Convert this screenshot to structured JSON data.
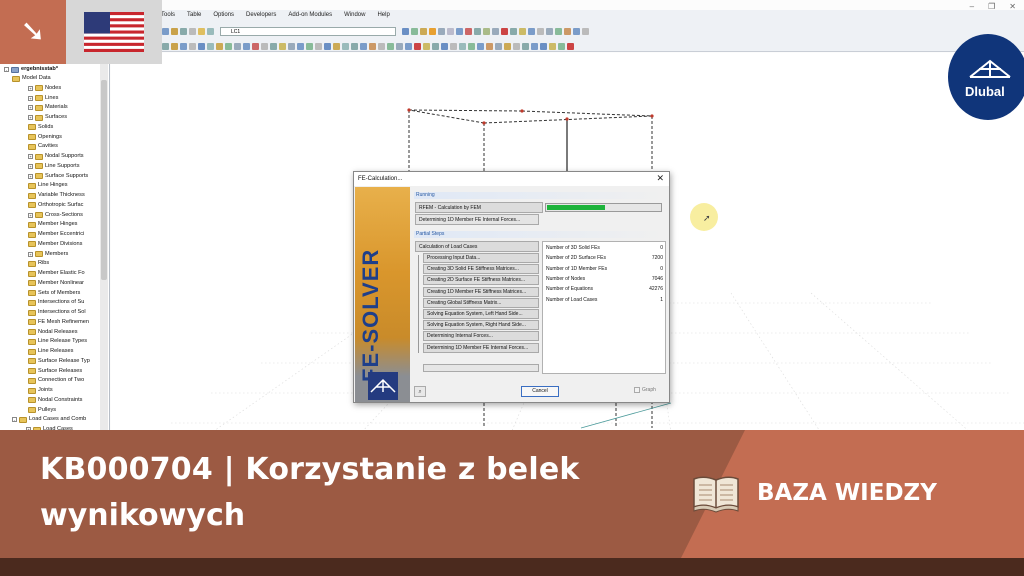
{
  "menu": [
    "Tools",
    "Table",
    "Options",
    "Developers",
    "Add-on Modules",
    "Window",
    "Help"
  ],
  "window_controls": [
    "–",
    "❐",
    "✕"
  ],
  "load_case_selector": {
    "value": "LC1"
  },
  "tree": {
    "root": "ergebnisstab*",
    "items": [
      "Model Data",
      "Nodes",
      "Lines",
      "Materials",
      "Surfaces",
      "Solids",
      "Openings",
      "Cavities",
      "Nodal Supports",
      "Line Supports",
      "Surface Supports",
      "Line Hinges",
      "Variable Thickness",
      "Orthotropic Surfac",
      "Cross-Sections",
      "Member Hinges",
      "Member Eccentrici",
      "Member Divisions",
      "Members",
      "Ribs",
      "Member Elastic Fo",
      "Member Nonlinear",
      "Sets of Members",
      "Intersections of Su",
      "Intersections of Sol",
      "FE Mesh Refinemen",
      "Nodal Releases",
      "Line Release Types",
      "Line Releases",
      "Surface Release Typ",
      "Surface Releases",
      "Connection of Two",
      "Joints",
      "Nodal Constraints",
      "Pulleys",
      "Load Cases and Comb",
      "Load Cases"
    ]
  },
  "dialog": {
    "title": "FE-Calculation...",
    "close": "✕",
    "banner_text": "FE-SOLVER",
    "running_header": "Running",
    "running": [
      "RFEM - Calculation by FEM",
      "Determining 1D Member FE Internal Forces..."
    ],
    "progress": 0.5,
    "partial_header": "Partial Steps",
    "partial_first": "Calculation of Load Cases",
    "steps": [
      "Processing Input Data...",
      "Creating 3D Solid FE Stiffness Matrices...",
      "Creating 2D Surface FE Stiffness Matrices...",
      "Creating 1D Member FE Stiffness Matrices...",
      "Creating Global Stiffness Matrix...",
      "Solving Equation System, Left Hand Side...",
      "Solving Equation System, Right Hand Side...",
      "Determining Internal Forces...",
      "Determining 1D Member FE Internal Forces..."
    ],
    "stats": [
      {
        "label": "Number of 3D Solid FEs",
        "value": "0"
      },
      {
        "label": "Number of 2D Surface FEs",
        "value": "7200"
      },
      {
        "label": "Number of 1D Member FEs",
        "value": "0"
      },
      {
        "label": "Number of Nodes",
        "value": "7046"
      },
      {
        "label": "Number of Equations",
        "value": "42276"
      },
      {
        "label": "Number of Load Cases",
        "value": "1"
      }
    ],
    "cancel": "Cancel",
    "graph": "Graph"
  },
  "brand": {
    "name": "Dlubal",
    "color": "#10357a"
  },
  "footer": {
    "title_line1": "KB000704 | Korzystanie z belek",
    "title_line2": "wynikowych",
    "category": "BAZA WIEDZY",
    "colors": {
      "main": "#9c5a43",
      "accent": "#c36d52",
      "dark": "#4b2a1e"
    }
  },
  "icons": [
    "arrow-down-right-icon",
    "us-flag-icon",
    "book-icon",
    "close-icon",
    "search-icon"
  ]
}
